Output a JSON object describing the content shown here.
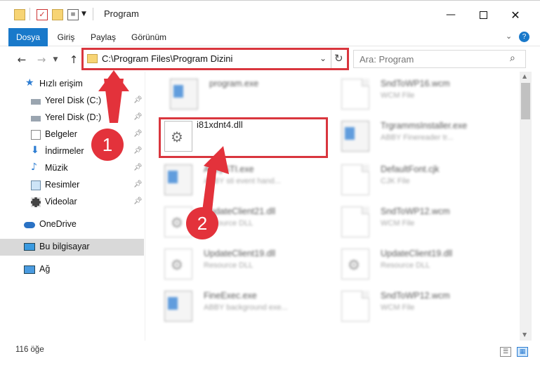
{
  "window": {
    "title": "Program",
    "minimize_icon": "minimize-icon",
    "maximize_icon": "maximize-icon",
    "close_icon": "close-icon"
  },
  "ribbon": {
    "tabs": [
      {
        "label": "Dosya",
        "active": true
      },
      {
        "label": "Giriş"
      },
      {
        "label": "Paylaş"
      },
      {
        "label": "Görünüm"
      }
    ],
    "help_icon": "?"
  },
  "address_bar": {
    "path": "C:\\Program Files\\Program Dizini"
  },
  "search": {
    "placeholder": "Ara: Program"
  },
  "sidebar": {
    "items": [
      {
        "label": "Hızlı erişim",
        "icon": "star-icon"
      },
      {
        "label": "Yerel Disk (C:)",
        "icon": "drive-icon",
        "pinned": true
      },
      {
        "label": "Yerel Disk (D:)",
        "icon": "drive-icon",
        "pinned": true
      },
      {
        "label": "Belgeler",
        "icon": "documents-icon",
        "pinned": true
      },
      {
        "label": "İndirmeler",
        "icon": "download-icon",
        "pinned": true
      },
      {
        "label": "Müzik",
        "icon": "music-icon",
        "pinned": true
      },
      {
        "label": "Resimler",
        "icon": "pictures-icon",
        "pinned": true
      },
      {
        "label": "Videolar",
        "icon": "video-icon",
        "pinned": true
      },
      {
        "label": "OneDrive",
        "icon": "cloud-icon"
      },
      {
        "label": "Bu bilgisayar",
        "icon": "computer-icon",
        "selected": true
      },
      {
        "label": "Ağ",
        "icon": "network-icon"
      }
    ]
  },
  "files": [
    {
      "name": "program.exe",
      "desc": "",
      "icon": "app-icon",
      "blurred": true
    },
    {
      "name": "SndToWP16.wcm",
      "desc": "WCM File",
      "icon": "document-icon",
      "blurred": true
    },
    {
      "name": "i81xdnt4.dll",
      "desc": "",
      "icon": "gear-file-icon",
      "blurred": false,
      "highlighted": true
    },
    {
      "name": "TrgrammsInstaller.exe",
      "desc": "ABBY Finereader tr...",
      "icon": "app-icon",
      "blurred": true
    },
    {
      "name": "AbbySTI.exe",
      "desc": "ABBY sti event hand...",
      "icon": "app-icon",
      "blurred": true
    },
    {
      "name": "DefaultFont.cjk",
      "desc": "CJK File",
      "icon": "document-icon",
      "blurred": true
    },
    {
      "name": "UpdateClient21.dll",
      "desc": "Resource DLL",
      "icon": "gear-file-icon",
      "blurred": true
    },
    {
      "name": "SndToWP12.wcm",
      "desc": "WCM File",
      "icon": "document-icon",
      "blurred": true
    },
    {
      "name": "UpdateClient19.dll",
      "desc": "Resource DLL",
      "icon": "gear-file-icon",
      "blurred": true
    },
    {
      "name": "UpdateClient19.dll",
      "desc": "Resource DLL",
      "icon": "gear-file-icon",
      "blurred": true
    },
    {
      "name": "FineExec.exe",
      "desc": "ABBY background exe...",
      "icon": "app-icon",
      "blurred": true
    },
    {
      "name": "SndToWP12.wcm",
      "desc": "WCM File",
      "icon": "document-icon",
      "blurred": true
    }
  ],
  "status": {
    "count": "116 öğe"
  },
  "annotations": {
    "step1": "1",
    "step2": "2",
    "accent": "#e3323b"
  }
}
